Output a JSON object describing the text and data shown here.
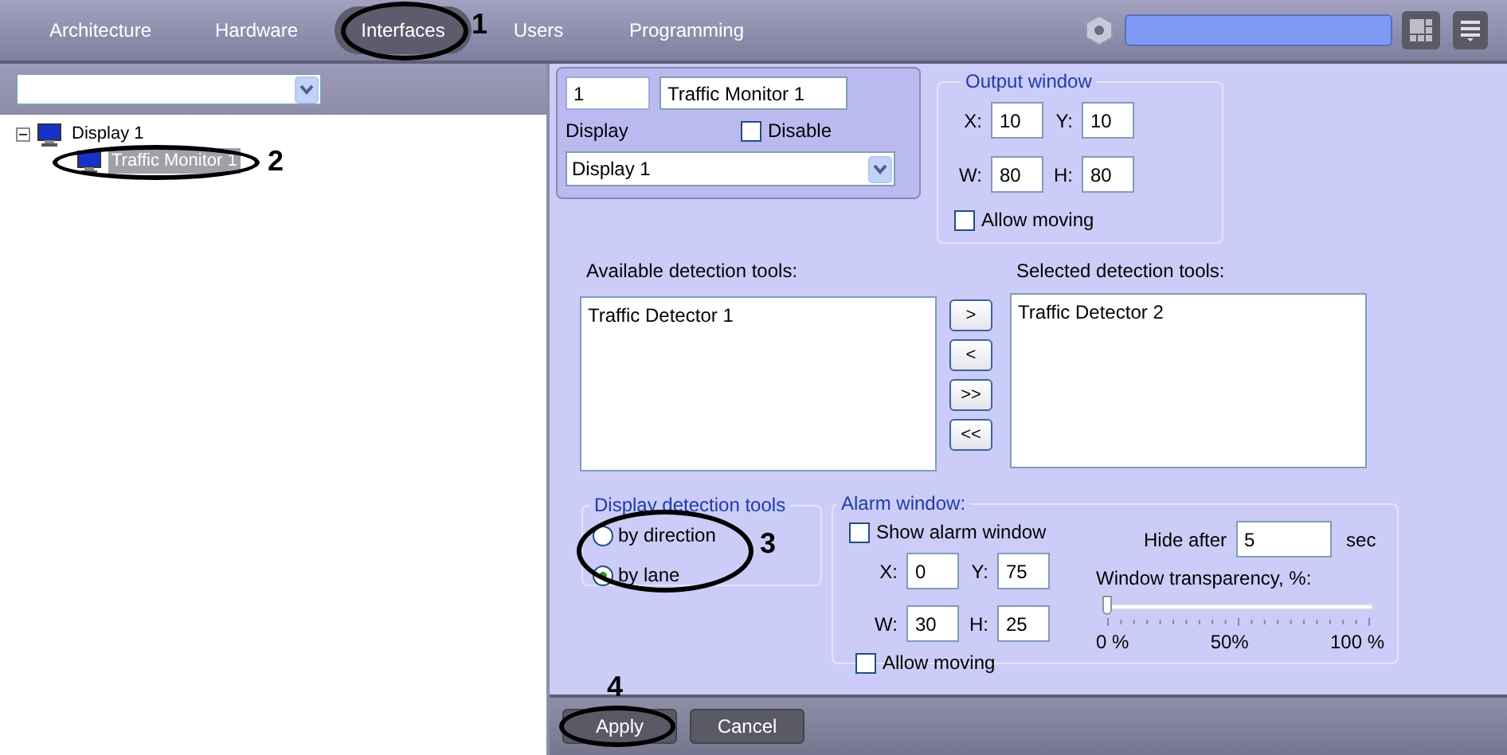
{
  "nav": {
    "tabs": [
      {
        "label": "Architecture",
        "selected": false
      },
      {
        "label": "Hardware",
        "selected": false
      },
      {
        "label": "Interfaces",
        "selected": true
      },
      {
        "label": "Users",
        "selected": false
      },
      {
        "label": "Programming",
        "selected": false
      }
    ]
  },
  "tree": {
    "items": [
      {
        "label": "Display 1",
        "expanded": true,
        "selected": false,
        "children": [
          {
            "label": "Traffic Monitor 1",
            "selected": true
          }
        ]
      }
    ]
  },
  "monitor": {
    "id": "1",
    "name": "Traffic Monitor 1",
    "display_label": "Display",
    "disable": {
      "label": "Disable",
      "checked": false
    },
    "display_select": "Display 1"
  },
  "output_window": {
    "title": "Output window",
    "fields": [
      {
        "label": "X:",
        "value": "10"
      },
      {
        "label": "Y:",
        "value": "10"
      },
      {
        "label": "W:",
        "value": "80"
      },
      {
        "label": "H:",
        "value": "80"
      }
    ],
    "allow_moving": {
      "label": "Allow moving",
      "checked": false
    }
  },
  "available_tools": {
    "title": "Available detection tools:",
    "items": [
      "Traffic Detector 1"
    ]
  },
  "move_buttons": [
    ">",
    "<",
    ">>",
    "<<"
  ],
  "selected_tools": {
    "title": "Selected detection tools:",
    "items": [
      "Traffic Detector 2"
    ]
  },
  "display_mode": {
    "title": "Display detection tools",
    "options": [
      {
        "label": "by direction",
        "selected": false
      },
      {
        "label": "by lane",
        "selected": true
      }
    ]
  },
  "alarm_window": {
    "title": "Alarm window:",
    "show": {
      "label": "Show alarm window",
      "checked": false
    },
    "fields": [
      {
        "label": "X:",
        "value": "0"
      },
      {
        "label": "Y:",
        "value": "75"
      },
      {
        "label": "W:",
        "value": "30"
      },
      {
        "label": "H:",
        "value": "25"
      }
    ],
    "allow_moving": {
      "label": "Allow moving",
      "checked": false
    },
    "hide_after": {
      "label": "Hide after",
      "value": "5",
      "unit": "sec"
    },
    "transparency": {
      "label": "Window transparency, %:",
      "level": 0,
      "scale": [
        "0 %",
        "50%",
        "100 %"
      ]
    }
  },
  "footer_buttons": [
    "Apply",
    "Cancel"
  ],
  "callouts": [
    "1",
    "2",
    "3",
    "4"
  ]
}
